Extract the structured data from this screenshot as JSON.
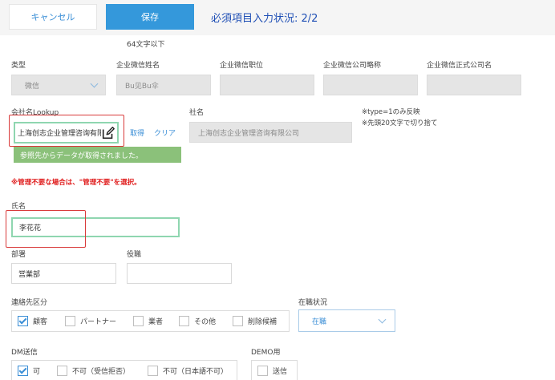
{
  "toolbar": {
    "cancel_label": "キャンセル",
    "save_label": "保存",
    "required_status": "必須項目入力状況: 2/2"
  },
  "hint_64": "64文字以下",
  "company_wechat": {
    "type_label": "类型",
    "type_value": "微信",
    "name_label": "企业微信姓名",
    "name_value": "Bu见Bu伞",
    "position_label": "企业微信职位",
    "position_value": "",
    "company_short_label": "企业微信公司略称",
    "company_short_value": "",
    "company_official_label": "企业微信正式公司名",
    "company_official_value": ""
  },
  "company_lookup": {
    "label": "会社名Lookup",
    "value": "上海创志企业管理咨询有限公司",
    "get_label": "取得",
    "clear_label": "クリア",
    "success_message": "参照先からデータが取得されました。"
  },
  "company_name": {
    "label": "社名",
    "value": "上海创志企业管理咨询有限公司"
  },
  "notes": {
    "line1": "※type=1のみ反映",
    "line2": "※先頭20文字で切り捨て"
  },
  "warning": "※管理不要な場合は、\"管理不要\"を選択。",
  "person": {
    "name_label": "氏名",
    "name_value": "李花花",
    "department_label": "部署",
    "department_value": "営業部",
    "title_label": "役職",
    "title_value": ""
  },
  "contact_category": {
    "label": "連絡先区分",
    "options": [
      {
        "label": "顧客",
        "checked": true
      },
      {
        "label": "パートナー",
        "checked": false
      },
      {
        "label": "業者",
        "checked": false
      },
      {
        "label": "その他",
        "checked": false
      },
      {
        "label": "削除候補",
        "checked": false
      }
    ]
  },
  "employment_status": {
    "label": "在職状況",
    "value": "在職"
  },
  "dm_send": {
    "label": "DM送信",
    "options": [
      {
        "label": "可",
        "checked": true
      },
      {
        "label": "不可（受信拒否）",
        "checked": false
      },
      {
        "label": "不可（日本語不可）",
        "checked": false
      }
    ]
  },
  "demo": {
    "label": "DEMO用",
    "option": {
      "label": "送信",
      "checked": false
    }
  },
  "colors": {
    "accent": "#3498db",
    "required_status": "#1f4fb5",
    "success": "#8bc17a",
    "highlight_border": "#8fd6b0",
    "annotation_red": "#d93a3a",
    "warning_text": "#e02020"
  },
  "icons": {
    "lookup_edit": "edit-icon",
    "select_arrow": "chevron-down-icon",
    "checkbox_checked": "check-icon"
  }
}
